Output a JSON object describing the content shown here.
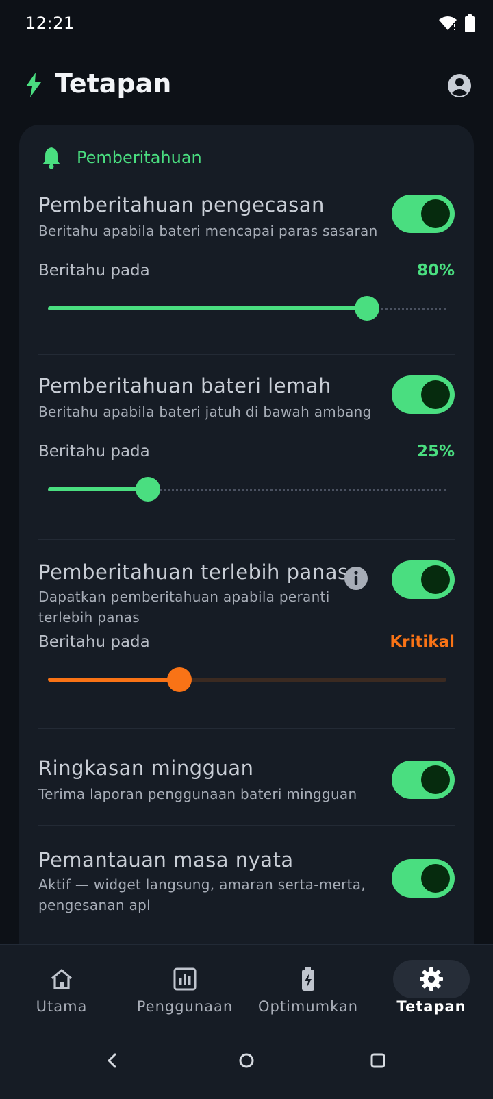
{
  "status_bar": {
    "time": "12:21",
    "icons": [
      "wifi-icon",
      "battery-icon"
    ]
  },
  "header": {
    "title": "Tetapan",
    "logo_icon": "bolt-icon",
    "account_icon": "account-circle-icon"
  },
  "section": {
    "title": "Pemberitahuan",
    "icon": "bell-icon"
  },
  "settings": [
    {
      "title": "Pemberitahuan pengecasan",
      "description": "Beritahu apabila bateri mencapai paras sasaran",
      "enabled": true,
      "slider": {
        "label": "Beritahu pada",
        "value_text": "80%",
        "fraction": 0.8,
        "color": "#4ade80"
      }
    },
    {
      "title": "Pemberitahuan bateri lemah",
      "description": "Beritahu apabila bateri jatuh di bawah ambang",
      "enabled": true,
      "slider": {
        "label": "Beritahu pada",
        "value_text": "25%",
        "fraction": 0.25,
        "color": "#4ade80"
      }
    },
    {
      "title": "Pemberitahuan terlebih panas",
      "description_lines": [
        "Dapatkan pemberitahuan apabila peranti",
        "terlebih panas"
      ],
      "enabled": true,
      "info_icon": "info-icon",
      "slider": {
        "label": "Beritahu pada",
        "value_text": "Kritikal",
        "fraction": 0.33,
        "color": "#f97316"
      }
    },
    {
      "title": "Ringkasan mingguan",
      "description": "Terima laporan penggunaan bateri mingguan",
      "enabled": true
    },
    {
      "title": "Pemantauan masa nyata",
      "description_lines": [
        "Aktif — widget langsung, amaran serta-merta,",
        "pengesanan apl"
      ],
      "enabled": true
    }
  ],
  "bottom_nav": [
    {
      "label": "Utama",
      "icon": "home-icon",
      "active": false
    },
    {
      "label": "Penggunaan",
      "icon": "bar-chart-icon",
      "active": false
    },
    {
      "label": "Optimumkan",
      "icon": "battery-charging-icon",
      "active": false
    },
    {
      "label": "Tetapan",
      "icon": "gear-icon",
      "active": true
    }
  ],
  "system_nav": [
    "back-icon",
    "home-circle-icon",
    "recents-icon"
  ],
  "colors": {
    "accent_green": "#4ade80",
    "accent_orange": "#f97316",
    "background": "#0d1117",
    "card": "#161c25"
  }
}
